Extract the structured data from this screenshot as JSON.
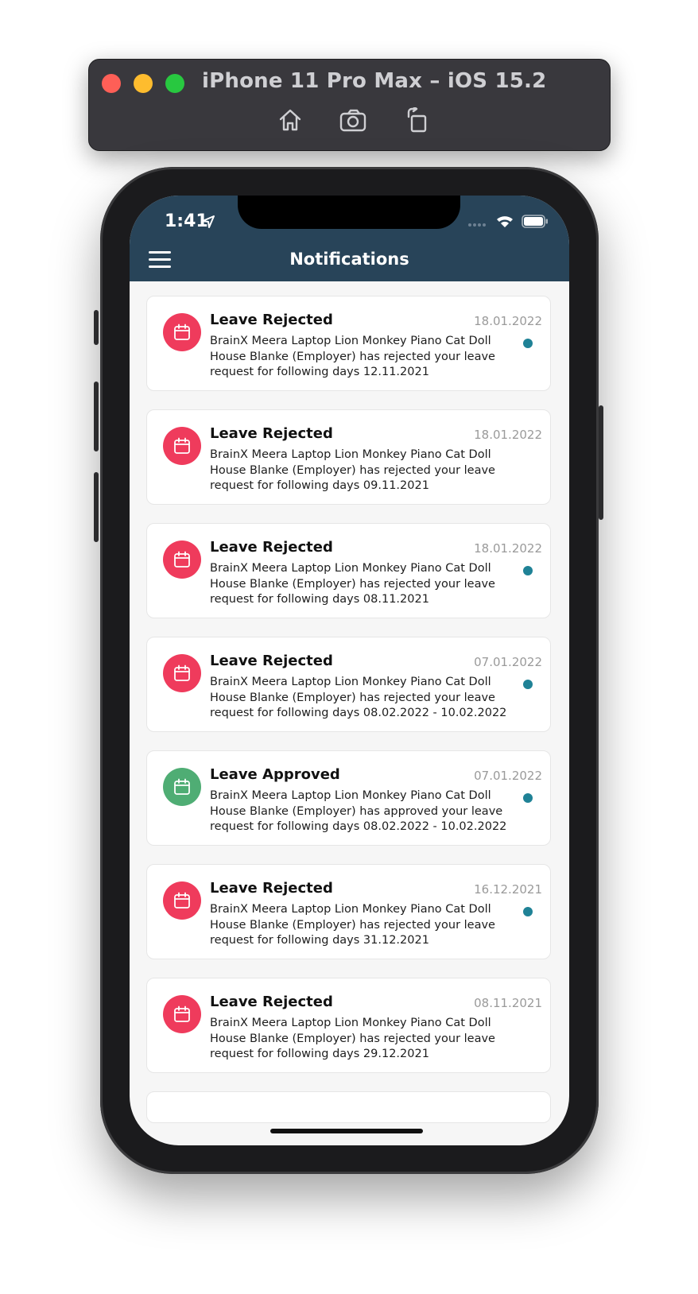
{
  "simulator": {
    "title": "iPhone 11 Pro Max – iOS 15.2",
    "tools": [
      "home-icon",
      "screenshot-icon",
      "rotate-icon"
    ]
  },
  "status_bar": {
    "time": "1:41"
  },
  "header": {
    "title": "Notifications"
  },
  "colors": {
    "navbar": "#284459",
    "rejected": "#ef3b5c",
    "approved": "#4fad74",
    "unread_dot": "#1f8296"
  },
  "notifications": [
    {
      "title": "Leave Rejected",
      "date": "18.01.2022",
      "status": "rejected",
      "unread": true,
      "lines": [
        "BrainX  Meera Laptop Lion Monkey Piano Cat Doll",
        "House Blanke (Employer) has rejected your leave",
        "request for following days 12.11.2021"
      ]
    },
    {
      "title": "Leave Rejected",
      "date": "18.01.2022",
      "status": "rejected",
      "unread": false,
      "lines": [
        "BrainX  Meera Laptop Lion Monkey Piano Cat Doll",
        "House Blanke (Employer) has rejected your leave",
        "request for following days 09.11.2021"
      ]
    },
    {
      "title": "Leave Rejected",
      "date": "18.01.2022",
      "status": "rejected",
      "unread": true,
      "lines": [
        "BrainX  Meera Laptop Lion Monkey Piano Cat Doll",
        "House Blanke (Employer) has rejected your leave",
        "request for following days 08.11.2021"
      ]
    },
    {
      "title": "Leave Rejected",
      "date": "07.01.2022",
      "status": "rejected",
      "unread": true,
      "lines": [
        "BrainX  Meera Laptop Lion Monkey Piano Cat Doll",
        "House Blanke (Employer) has rejected your leave",
        "request for following days 08.02.2022 - 10.02.2022"
      ]
    },
    {
      "title": "Leave Approved",
      "date": "07.01.2022",
      "status": "approved",
      "unread": true,
      "lines": [
        "BrainX  Meera Laptop Lion Monkey Piano Cat Doll",
        "House Blanke (Employer) has approved your leave",
        "request for following days 08.02.2022 - 10.02.2022"
      ]
    },
    {
      "title": "Leave Rejected",
      "date": "16.12.2021",
      "status": "rejected",
      "unread": true,
      "lines": [
        "BrainX  Meera Laptop Lion Monkey Piano Cat Doll",
        "House Blanke (Employer) has rejected your leave",
        "request for following days 31.12.2021"
      ]
    },
    {
      "title": "Leave Rejected",
      "date": "08.11.2021",
      "status": "rejected",
      "unread": false,
      "lines": [
        "BrainX  Meera Laptop Lion Monkey Piano Cat Doll",
        "House Blanke (Employer) has rejected your leave",
        "request for following days 29.12.2021"
      ]
    }
  ]
}
